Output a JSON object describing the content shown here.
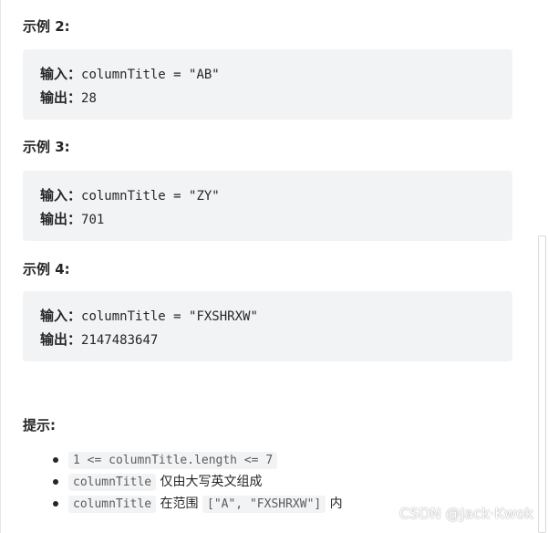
{
  "examples": [
    {
      "heading": "示例 2:",
      "input_label": "输入：",
      "input_value": "columnTitle = \"AB\"",
      "output_label": "输出：",
      "output_value": "28"
    },
    {
      "heading": "示例 3:",
      "input_label": "输入：",
      "input_value": "columnTitle = \"ZY\"",
      "output_label": "输出：",
      "output_value": "701"
    },
    {
      "heading": "示例 4:",
      "input_label": "输入：",
      "input_value": "columnTitle = \"FXSHRXW\"",
      "output_label": "输出：",
      "output_value": "2147483647"
    }
  ],
  "hints": {
    "title": "提示:",
    "items": [
      {
        "code": "1 <= columnTitle.length <= 7",
        "text": ""
      },
      {
        "code": "columnTitle",
        "text": " 仅由大写英文组成"
      },
      {
        "code": "columnTitle",
        "text": " 在范围 ",
        "code2": "[\"A\", \"FXSHRXW\"]",
        "text2": " 内"
      }
    ]
  },
  "watermark": "CSDN @Jack·Kwok"
}
